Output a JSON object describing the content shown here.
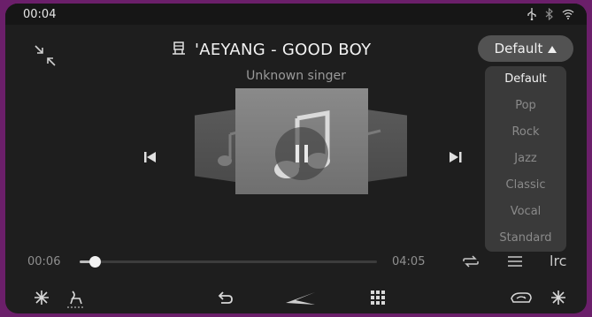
{
  "status": {
    "time": "00:04"
  },
  "player": {
    "title": "'AEYANG - GOOD BOY",
    "artist": "Unknown singer",
    "elapsed": "00:06",
    "total": "04:05",
    "progress_fraction": 0.05,
    "lrc_label": "lrc"
  },
  "equalizer": {
    "selected": "Default",
    "options": [
      "Default",
      "Pop",
      "Rock",
      "Jazz",
      "Classic",
      "Vocal",
      "Standard"
    ]
  },
  "colors": {
    "frame": "#6b1f6a",
    "background": "#1e1e1e",
    "accent": "#f2f2f2"
  }
}
